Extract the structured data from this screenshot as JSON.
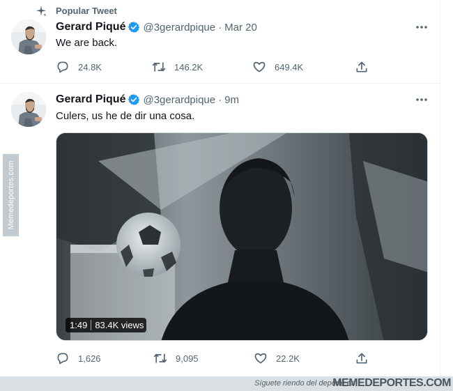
{
  "popular": {
    "label": "Popular Tweet",
    "icon": "sparkle-icon"
  },
  "tweets": [
    {
      "name": "Gerard Piqué",
      "handle": "@3gerardpique",
      "separator": "·",
      "time": "Mar 20",
      "text": "We are back.",
      "replies": "24.8K",
      "retweets": "146.2K",
      "likes": "649.4K"
    },
    {
      "name": "Gerard Piqué",
      "handle": "@3gerardpique",
      "separator": "·",
      "time": "9m",
      "text": "Culers, us he de dir una cosa.",
      "replies": "1,626",
      "retweets": "9,095",
      "likes": "22.2K",
      "video": {
        "duration": "1:49",
        "views": "83.4K views"
      }
    }
  ],
  "watermark": {
    "side": "Memedeportes.com",
    "slogan": "Síguete riendo del deporte en",
    "brand": "MEMEDEPORTES.COM"
  },
  "colors": {
    "verified": "#1d9bf0",
    "secondary_text": "#536471",
    "primary_text": "#0f1419",
    "divider": "#eff3f4"
  }
}
